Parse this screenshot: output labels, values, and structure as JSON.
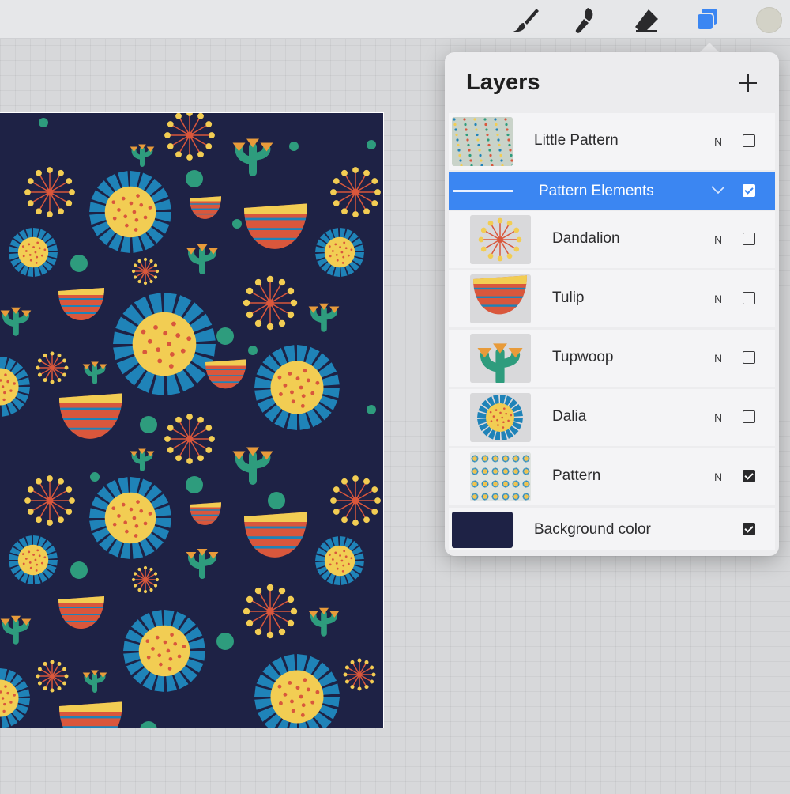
{
  "toolbar": {
    "tools": [
      {
        "name": "brush-icon",
        "active": false
      },
      {
        "name": "smudge-icon",
        "active": false
      },
      {
        "name": "eraser-icon",
        "active": false
      },
      {
        "name": "layers-icon",
        "active": true
      }
    ],
    "active_color": "#3b86f2",
    "color_well": "#d3d2c7"
  },
  "layers_panel": {
    "title": "Layers",
    "add_icon": "plus-icon",
    "layers": [
      {
        "name": "Little Pattern",
        "blend": "N",
        "visible": false,
        "thumbnail": "small-pattern"
      },
      {
        "name": "Pattern Elements",
        "type": "group",
        "expanded": true,
        "visible": true,
        "selected": true
      },
      {
        "name": "Dandalion",
        "blend": "N",
        "visible": false,
        "thumbnail": "dandelion"
      },
      {
        "name": "Tulip",
        "blend": "N",
        "visible": false,
        "thumbnail": "tulip"
      },
      {
        "name": "Tupwoop",
        "blend": "N",
        "visible": false,
        "thumbnail": "tupwoop"
      },
      {
        "name": "Dalia",
        "blend": "N",
        "visible": false,
        "thumbnail": "dalia"
      },
      {
        "name": "Pattern",
        "blend": "N",
        "visible": true,
        "thumbnail": "pattern"
      },
      {
        "name": "Background color",
        "visible": true,
        "thumbnail": "color-swatch",
        "color": "#1e2245"
      }
    ]
  },
  "palette": {
    "navy": "#1e2245",
    "blue": "#1f83b8",
    "yellow": "#f2cd53",
    "orange": "#d9573c",
    "green": "#2e9c7d",
    "gold": "#e89b3a"
  }
}
